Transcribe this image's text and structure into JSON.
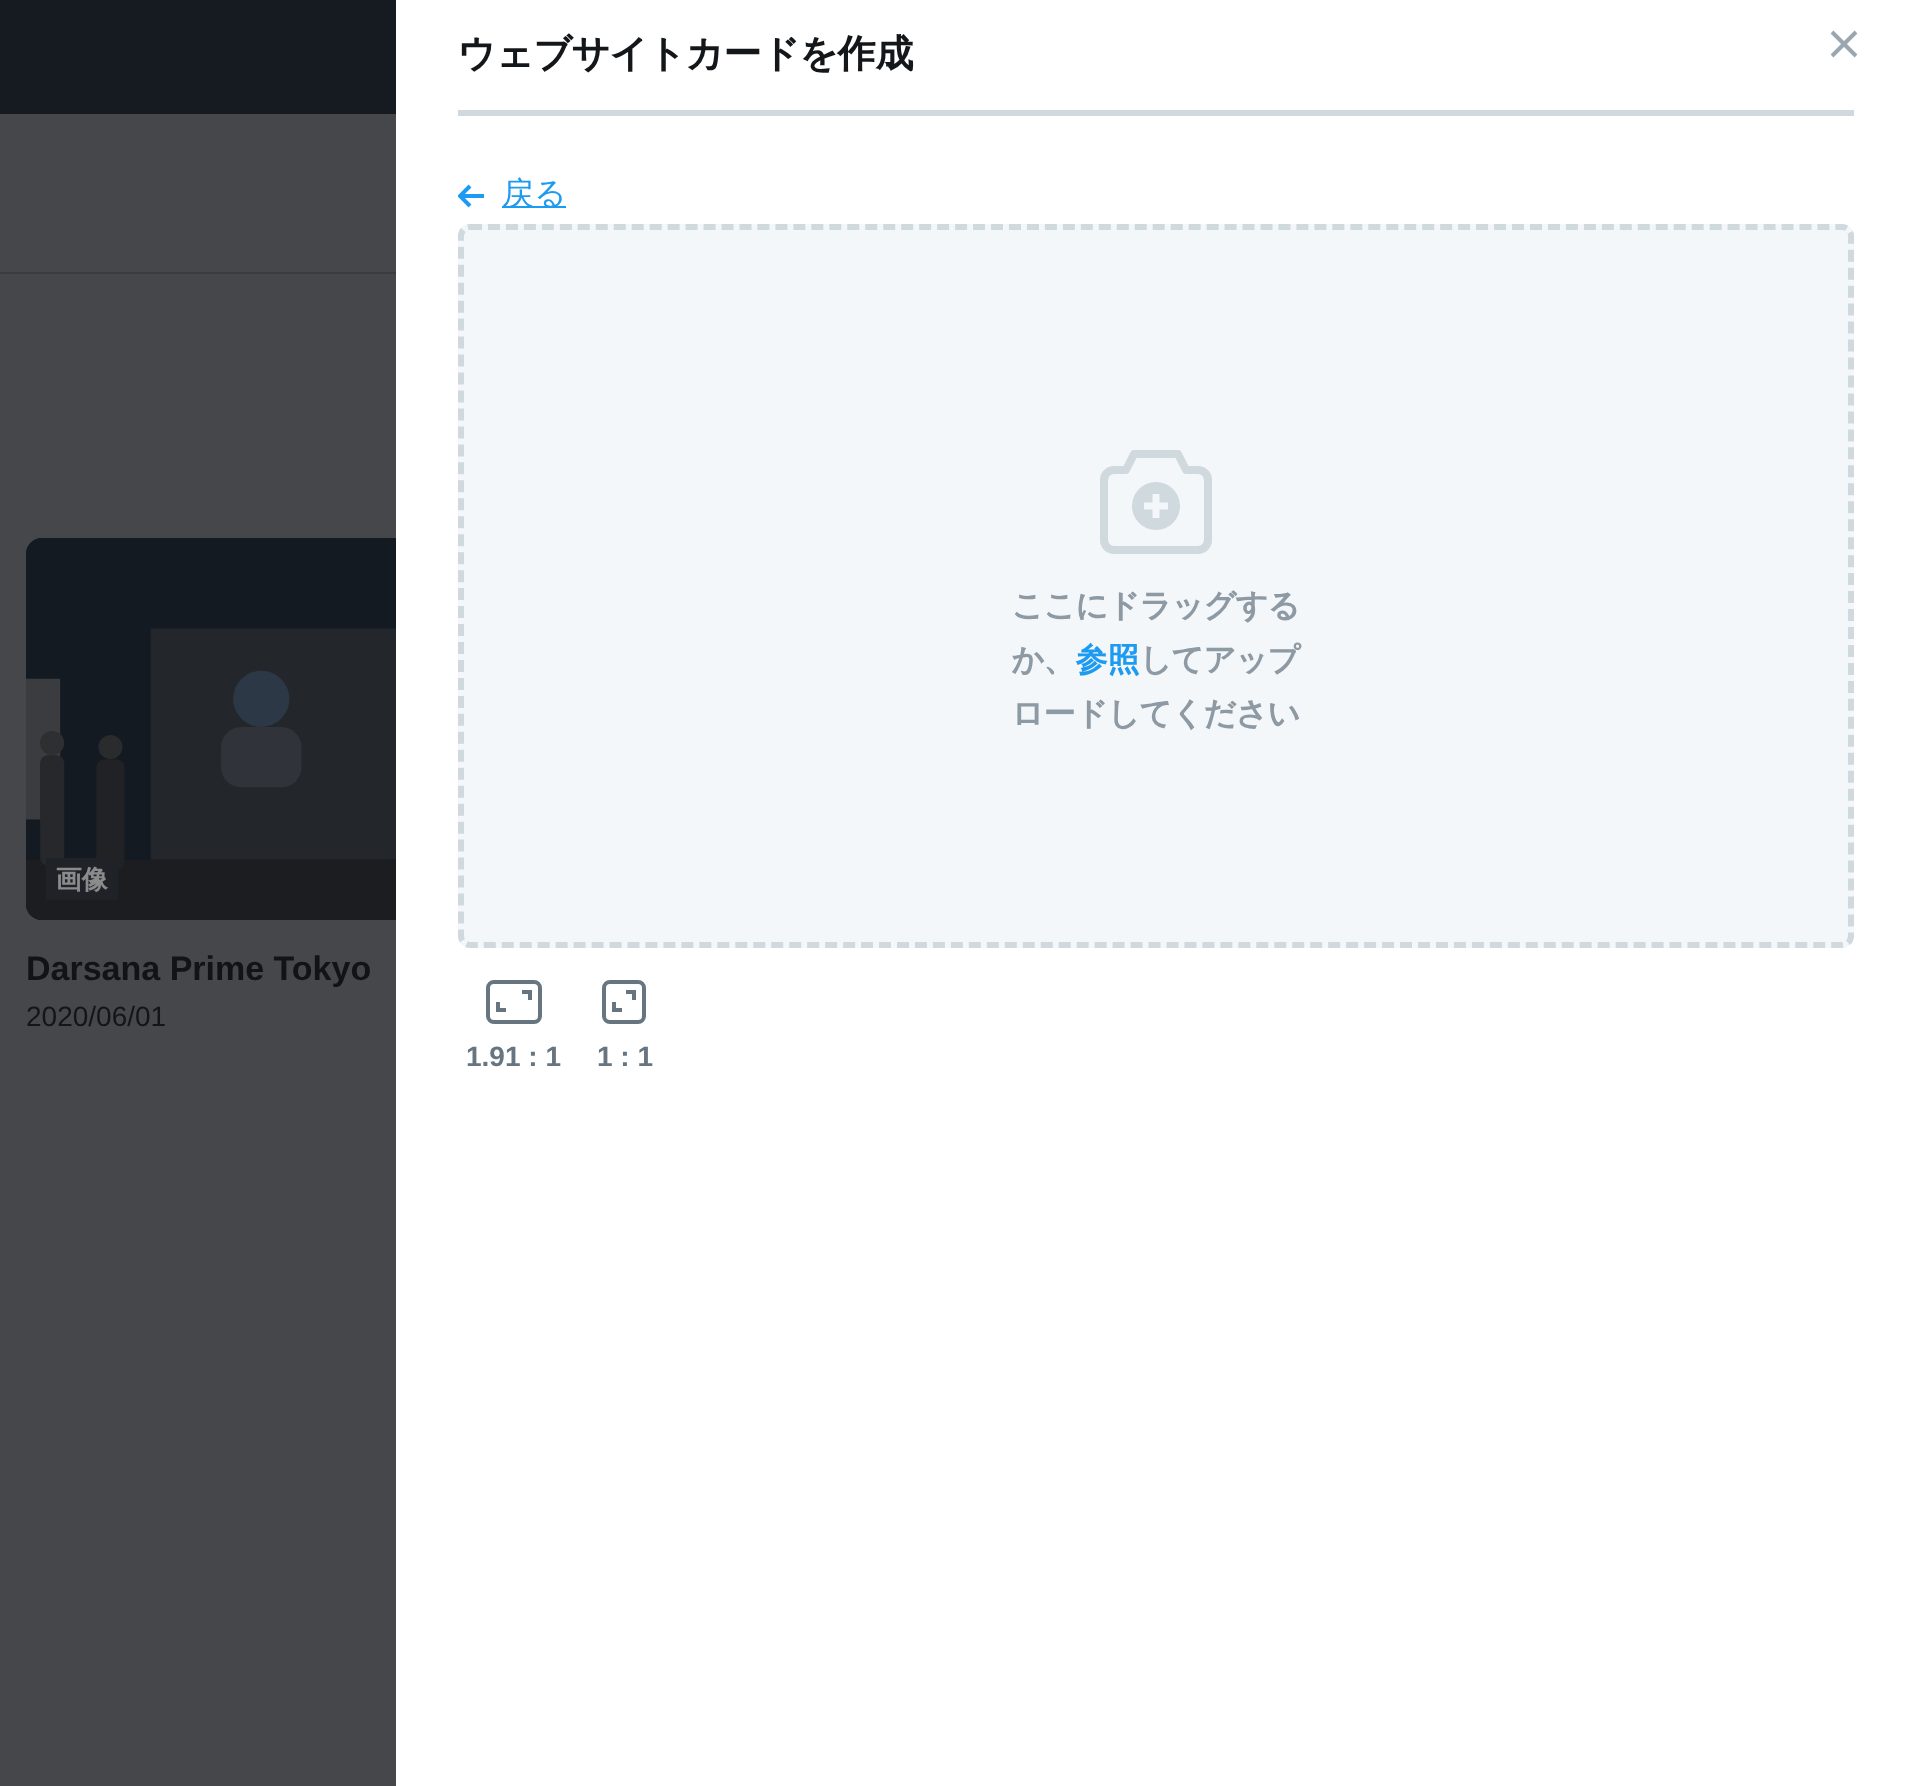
{
  "background_page": {
    "card": {
      "kind": "picture",
      "badge": "画像",
      "title": "Darsana Prime Tokyo",
      "date": "2020/06/01"
    }
  },
  "panel": {
    "title": "ウェブサイトカードを作成",
    "back_link": "戻る",
    "dropzone": {
      "text_before": "ここにドラッグするか、",
      "browse_link": "参照",
      "text_after": "してアップロードしてください"
    },
    "aspect_options": [
      {
        "label": "1.91 : 1",
        "kind": "wide"
      },
      {
        "label": "1 : 1",
        "kind": "square"
      }
    ]
  }
}
